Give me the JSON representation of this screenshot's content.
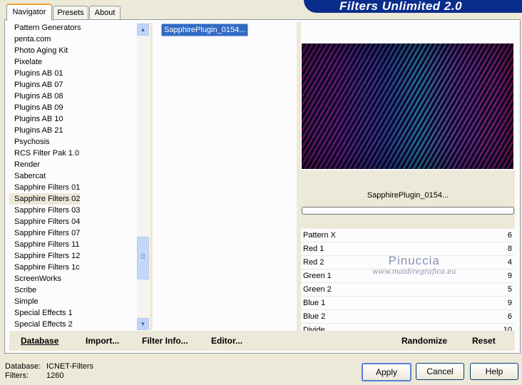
{
  "banner": {
    "title": "Filters Unlimited 2.0"
  },
  "tabs": [
    {
      "label": "Navigator"
    },
    {
      "label": "Presets"
    },
    {
      "label": "About"
    }
  ],
  "categories": [
    "Pattern Generators",
    "penta.com",
    "Photo Aging Kit",
    "Pixelate",
    "Plugins AB 01",
    "Plugins AB 07",
    "Plugins AB 08",
    "Plugins AB 09",
    "Plugins AB 10",
    "Plugins AB 21",
    "Psychosis",
    "RCS Filter Pak 1.0",
    "Render",
    "Sabercat",
    "Sapphire Filters 01",
    "Sapphire Filters 02",
    "Sapphire Filters 03",
    "Sapphire Filters 04",
    "Sapphire Filters 07",
    "Sapphire Filters 11",
    "Sapphire Filters 12",
    "Sapphire Filters 1c",
    "ScreenWorks",
    "Scribe",
    "Simple",
    "Special Effects 1",
    "Special Effects 2"
  ],
  "selected_category": "Sapphire Filters 02",
  "effects": [
    "SapphirePlugin_0154..."
  ],
  "effect_name": "SapphirePlugin_0154...",
  "params": [
    {
      "name": "Pattern X",
      "value": "6"
    },
    {
      "name": "Red 1",
      "value": "8"
    },
    {
      "name": "Red 2",
      "value": "4"
    },
    {
      "name": "Green 1",
      "value": "9"
    },
    {
      "name": "Green 2",
      "value": "5"
    },
    {
      "name": "Blue 1",
      "value": "9"
    },
    {
      "name": "Blue 2",
      "value": "6"
    },
    {
      "name": "Divide",
      "value": "10"
    }
  ],
  "watermark": {
    "line1": "Pinuccia",
    "line2": "www.maidiregrafica.eu"
  },
  "buttons": {
    "database": "Database",
    "import": "Import...",
    "filter_info": "Filter Info...",
    "editor": "Editor...",
    "randomize": "Randomize",
    "reset": "Reset",
    "apply": "Apply",
    "cancel": "Cancel",
    "help": "Help"
  },
  "status": {
    "database_label": "Database:",
    "database_value": "ICNET-Filters",
    "filters_label": "Filters:",
    "filters_value": "1260"
  }
}
